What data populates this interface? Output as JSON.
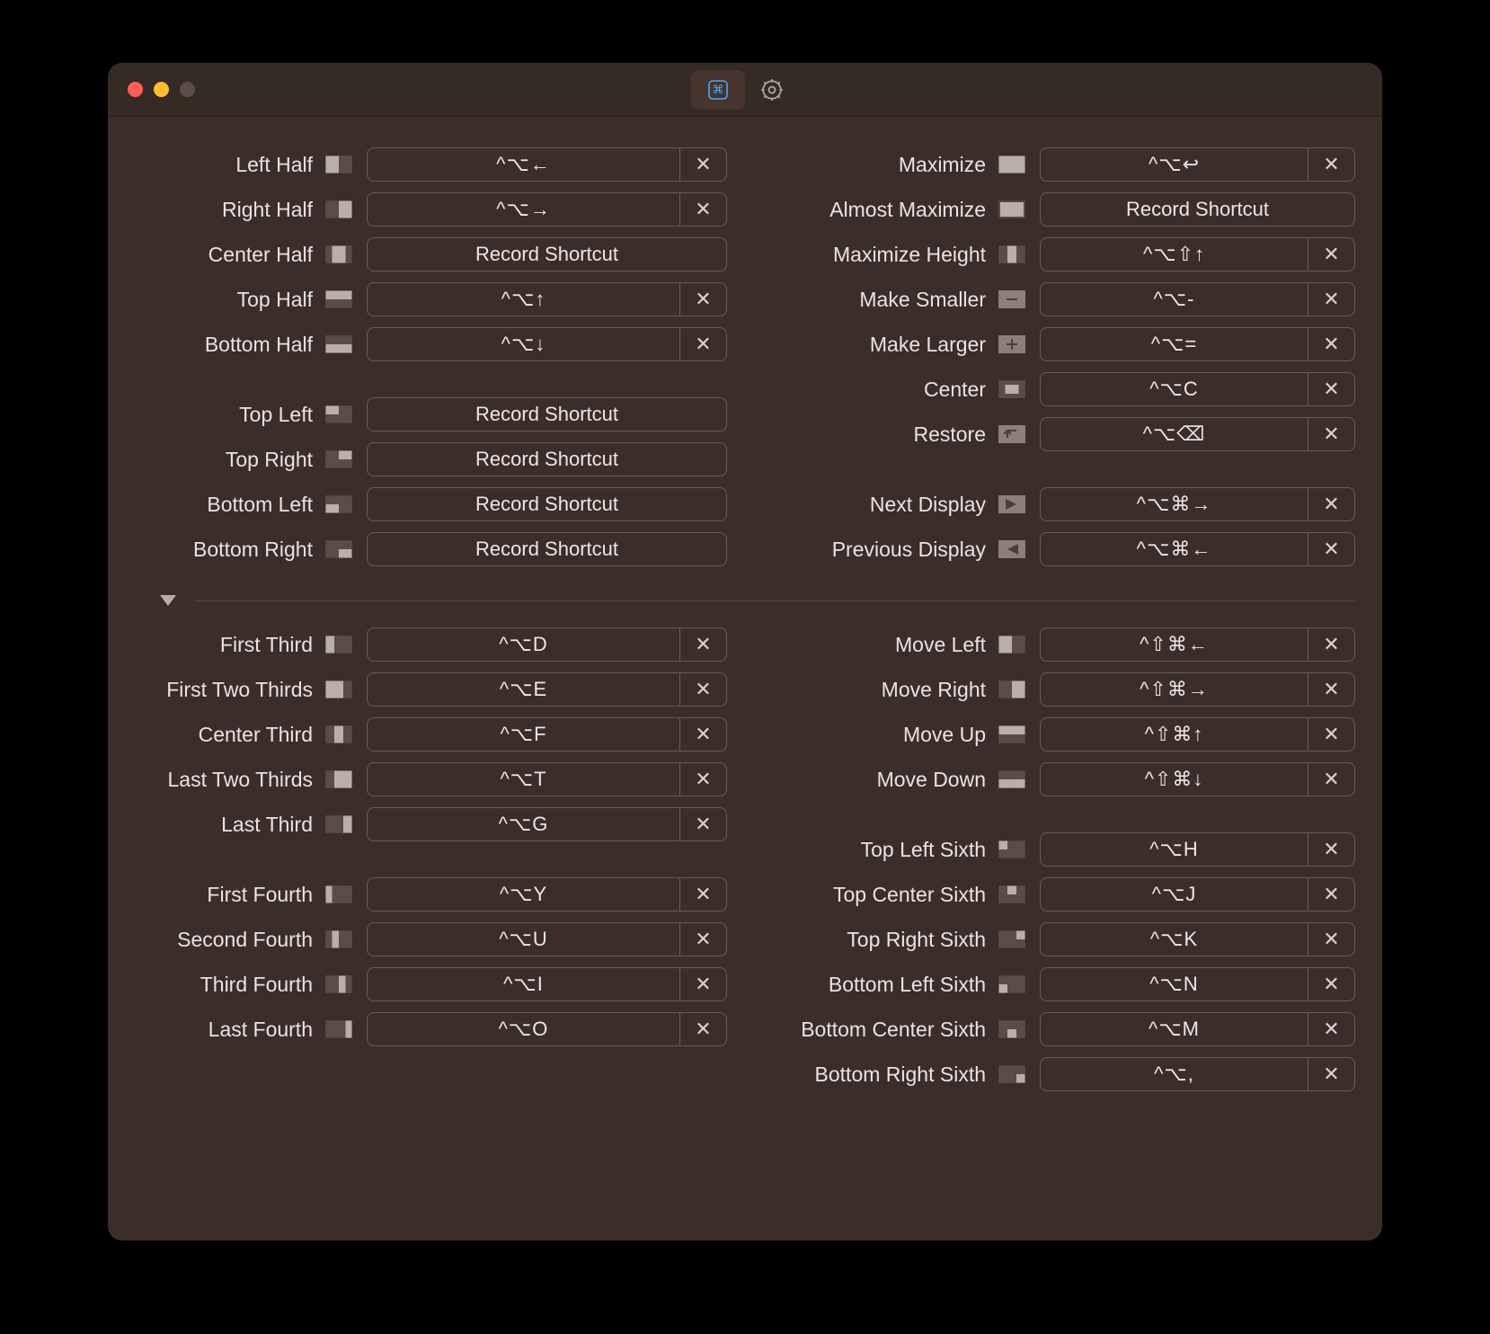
{
  "record_label": "Record Shortcut",
  "clear_glyph": "✕",
  "toolbar": {
    "active_tab": "shortcuts"
  },
  "top": {
    "left": [
      {
        "items": [
          {
            "id": "left-half",
            "label": "Left Half",
            "shortcut": "^⌥←",
            "glyph": "left-half"
          },
          {
            "id": "right-half",
            "label": "Right Half",
            "shortcut": "^⌥→",
            "glyph": "right-half"
          },
          {
            "id": "center-half",
            "label": "Center Half",
            "shortcut": null,
            "glyph": "center-half"
          },
          {
            "id": "top-half",
            "label": "Top Half",
            "shortcut": "^⌥↑",
            "glyph": "top-half"
          },
          {
            "id": "bottom-half",
            "label": "Bottom Half",
            "shortcut": "^⌥↓",
            "glyph": "bottom-half"
          }
        ]
      },
      {
        "items": [
          {
            "id": "top-left",
            "label": "Top Left",
            "shortcut": null,
            "glyph": "top-left"
          },
          {
            "id": "top-right",
            "label": "Top Right",
            "shortcut": null,
            "glyph": "top-right"
          },
          {
            "id": "bottom-left",
            "label": "Bottom Left",
            "shortcut": null,
            "glyph": "bottom-left"
          },
          {
            "id": "bottom-right",
            "label": "Bottom Right",
            "shortcut": null,
            "glyph": "bottom-right"
          }
        ]
      }
    ],
    "right": [
      {
        "items": [
          {
            "id": "maximize",
            "label": "Maximize",
            "shortcut": "^⌥↩",
            "glyph": "maximize"
          },
          {
            "id": "almost-maximize",
            "label": "Almost Maximize",
            "shortcut": null,
            "glyph": "almost-maximize"
          },
          {
            "id": "maximize-height",
            "label": "Maximize Height",
            "shortcut": "^⌥⇧↑",
            "glyph": "maximize-height"
          },
          {
            "id": "make-smaller",
            "label": "Make Smaller",
            "shortcut": "^⌥-",
            "glyph": "minus"
          },
          {
            "id": "make-larger",
            "label": "Make Larger",
            "shortcut": "^⌥=",
            "glyph": "plus"
          },
          {
            "id": "center",
            "label": "Center",
            "shortcut": "^⌥C",
            "glyph": "center"
          },
          {
            "id": "restore",
            "label": "Restore",
            "shortcut": "^⌥⌫",
            "glyph": "restore"
          }
        ]
      },
      {
        "items": [
          {
            "id": "next-display",
            "label": "Next Display",
            "shortcut": "^⌥⌘→",
            "glyph": "next-display"
          },
          {
            "id": "previous-display",
            "label": "Previous Display",
            "shortcut": "^⌥⌘←",
            "glyph": "prev-display"
          }
        ]
      }
    ]
  },
  "bottom": {
    "left": [
      {
        "items": [
          {
            "id": "first-third",
            "label": "First Third",
            "shortcut": "^⌥D",
            "glyph": "first-third"
          },
          {
            "id": "first-two-thirds",
            "label": "First Two Thirds",
            "shortcut": "^⌥E",
            "glyph": "first-two-thirds"
          },
          {
            "id": "center-third",
            "label": "Center Third",
            "shortcut": "^⌥F",
            "glyph": "center-third"
          },
          {
            "id": "last-two-thirds",
            "label": "Last Two Thirds",
            "shortcut": "^⌥T",
            "glyph": "last-two-thirds"
          },
          {
            "id": "last-third",
            "label": "Last Third",
            "shortcut": "^⌥G",
            "glyph": "last-third"
          }
        ]
      },
      {
        "items": [
          {
            "id": "first-fourth",
            "label": "First Fourth",
            "shortcut": "^⌥Y",
            "glyph": "first-fourth"
          },
          {
            "id": "second-fourth",
            "label": "Second Fourth",
            "shortcut": "^⌥U",
            "glyph": "second-fourth"
          },
          {
            "id": "third-fourth",
            "label": "Third Fourth",
            "shortcut": "^⌥I",
            "glyph": "third-fourth"
          },
          {
            "id": "last-fourth",
            "label": "Last Fourth",
            "shortcut": "^⌥O",
            "glyph": "last-fourth"
          }
        ]
      }
    ],
    "right": [
      {
        "items": [
          {
            "id": "move-left",
            "label": "Move Left",
            "shortcut": "^⇧⌘←",
            "glyph": "move-left"
          },
          {
            "id": "move-right",
            "label": "Move Right",
            "shortcut": "^⇧⌘→",
            "glyph": "move-right"
          },
          {
            "id": "move-up",
            "label": "Move Up",
            "shortcut": "^⇧⌘↑",
            "glyph": "move-up"
          },
          {
            "id": "move-down",
            "label": "Move Down",
            "shortcut": "^⇧⌘↓",
            "glyph": "move-down"
          }
        ]
      },
      {
        "items": [
          {
            "id": "top-left-sixth",
            "label": "Top Left Sixth",
            "shortcut": "^⌥H",
            "glyph": "tl6"
          },
          {
            "id": "top-center-sixth",
            "label": "Top Center Sixth",
            "shortcut": "^⌥J",
            "glyph": "tc6"
          },
          {
            "id": "top-right-sixth",
            "label": "Top Right Sixth",
            "shortcut": "^⌥K",
            "glyph": "tr6"
          },
          {
            "id": "bottom-left-sixth",
            "label": "Bottom Left Sixth",
            "shortcut": "^⌥N",
            "glyph": "bl6"
          },
          {
            "id": "bottom-center-sixth",
            "label": "Bottom Center Sixth",
            "shortcut": "^⌥M",
            "glyph": "bc6"
          },
          {
            "id": "bottom-right-sixth",
            "label": "Bottom Right Sixth",
            "shortcut": "^⌥,",
            "glyph": "br6"
          }
        ]
      }
    ]
  }
}
